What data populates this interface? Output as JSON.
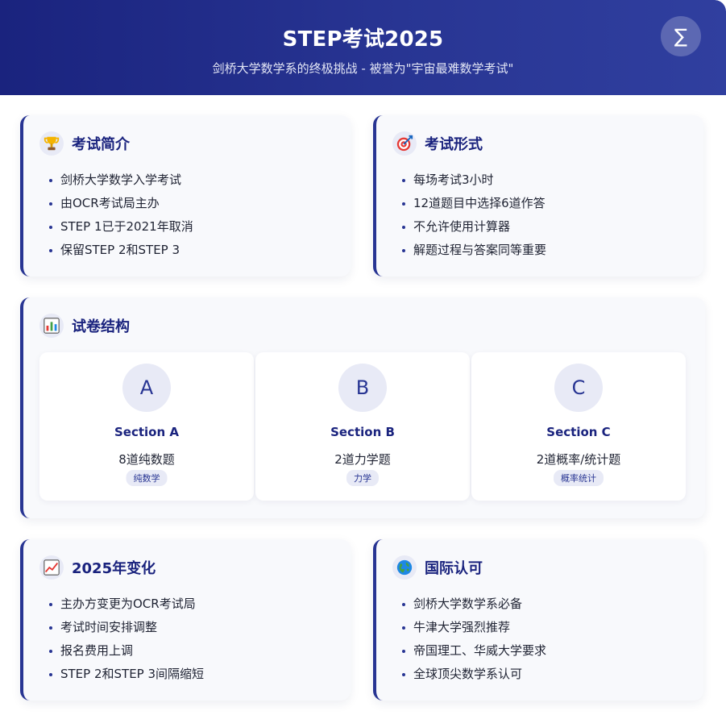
{
  "header": {
    "title": "STEP考试2025",
    "subtitle": "剑桥大学数学系的终极挑战 - 被誉为\"宇宙最难数学考试\"",
    "badge_symbol": "∑"
  },
  "cards": {
    "intro": {
      "title": "考试简介",
      "icon": "trophy-icon",
      "items": [
        "剑桥大学数学入学考试",
        "由OCR考试局主办",
        "STEP 1已于2021年取消",
        "保留STEP 2和STEP 3"
      ]
    },
    "format": {
      "title": "考试形式",
      "icon": "target-icon",
      "items": [
        "每场考试3小时",
        "12道题目中选择6道作答",
        "不允许使用计算器",
        "解题过程与答案同等重要"
      ]
    },
    "structure": {
      "title": "试卷结构",
      "icon": "bar-chart-icon",
      "sections": [
        {
          "letter": "A",
          "name": "Section A",
          "desc": "8道纯数题",
          "tag": "纯数学"
        },
        {
          "letter": "B",
          "name": "Section B",
          "desc": "2道力学题",
          "tag": "力学"
        },
        {
          "letter": "C",
          "name": "Section C",
          "desc": "2道概率/统计题",
          "tag": "概率统计"
        }
      ]
    },
    "changes": {
      "title": "2025年变化",
      "icon": "trend-chart-icon",
      "items": [
        "主办方变更为OCR考试局",
        "考试时间安排调整",
        "报名费用上调",
        "STEP 2和STEP 3间隔缩短"
      ]
    },
    "recognition": {
      "title": "国际认可",
      "icon": "globe-icon",
      "items": [
        "剑桥大学数学系必备",
        "牛津大学强烈推荐",
        "帝国理工、华威大学要求",
        "全球顶尖数学系认可"
      ]
    }
  },
  "colors": {
    "primary": "#1a237e",
    "accent": "#283593",
    "card_bg": "#f8f9fc",
    "chip_bg": "#e8eaf6"
  }
}
